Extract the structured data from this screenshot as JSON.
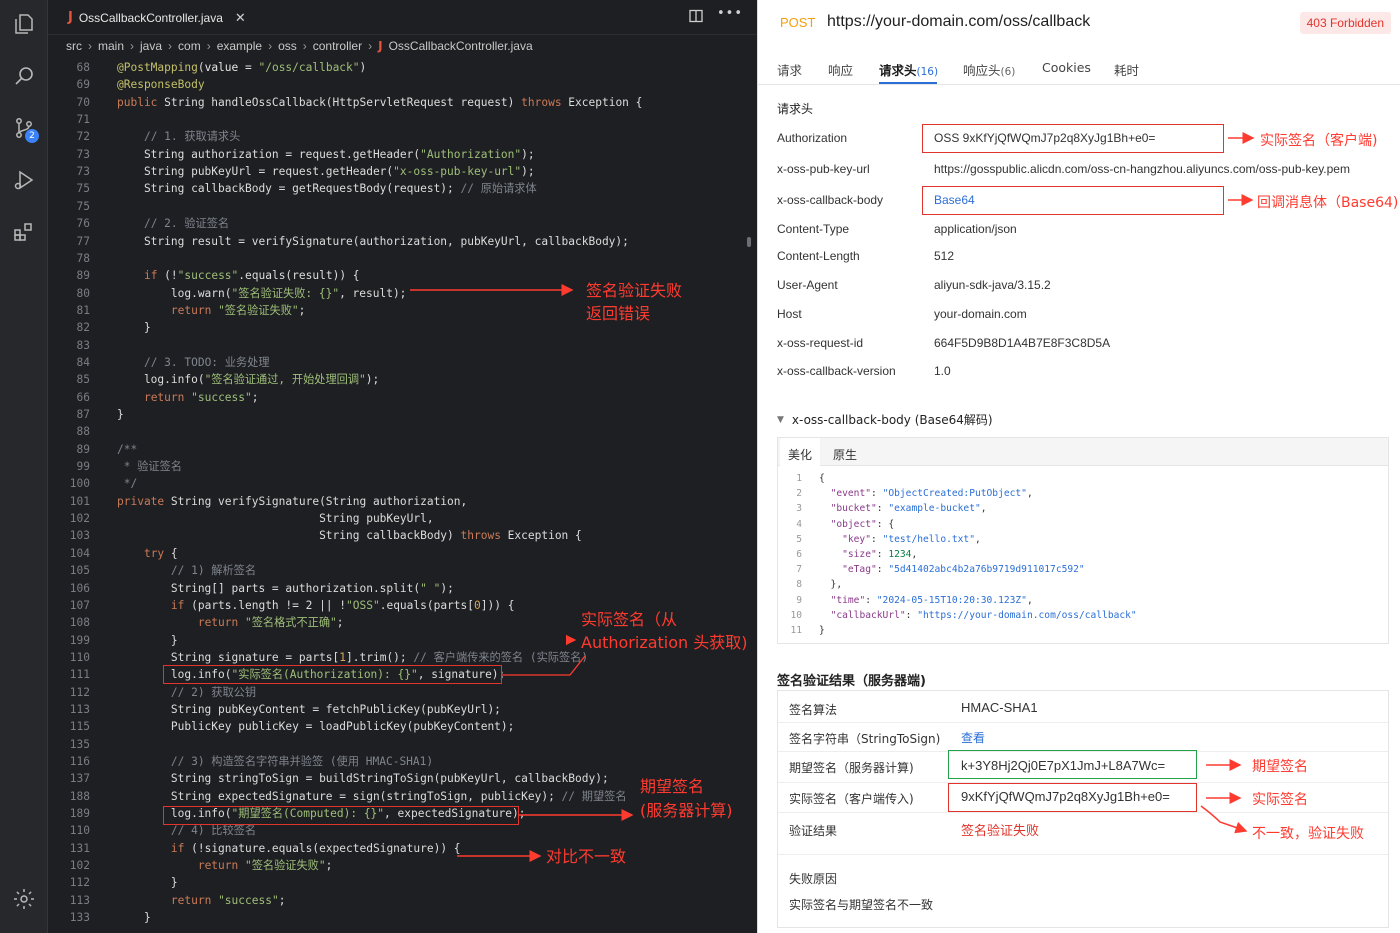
{
  "editor": {
    "tab": {
      "icon": "J",
      "filename": "OssCallbackController.java",
      "close": "✕"
    },
    "breadcrumb": [
      "src",
      "main",
      "java",
      "com",
      "example",
      "oss",
      "controller"
    ],
    "breadcrumb_file_icon": "J",
    "breadcrumb_file": "OssCallbackController.java",
    "badge_count": "2",
    "annotations": {
      "verify_fail": "签名验证失败",
      "return_error": "返回错误",
      "actual_sig_line1": "实际签名（从",
      "actual_sig_line2": "Authorization 头获取)",
      "expected_sig_line1": "期望签名",
      "expected_sig_line2": "(服务器计算)",
      "mismatch": "对比不一致"
    }
  },
  "inspector": {
    "method": "POST",
    "url": "https://your-domain.com/oss/callback",
    "status": "403 Forbidden",
    "tabs": [
      {
        "label": "请求",
        "count": ""
      },
      {
        "label": "响应",
        "count": ""
      },
      {
        "label": "请求头",
        "count": "(16)"
      },
      {
        "label": "响应头",
        "count": "(6)"
      },
      {
        "label": "Cookies",
        "count": ""
      },
      {
        "label": "耗时",
        "count": ""
      }
    ],
    "headers_title": "请求头",
    "headers": [
      {
        "key": "Authorization",
        "value": "OSS 9xKfYjQfWQmJ7p2q8XyJg1Bh+e0="
      },
      {
        "key": "x-oss-pub-key-url",
        "value": "https://gosspublic.alicdn.com/oss-cn-hangzhou.aliyuncs.com/oss-pub-key.pem"
      },
      {
        "key": "x-oss-callback-body",
        "value": "Base64"
      },
      {
        "key": "Content-Type",
        "value": "application/json"
      },
      {
        "key": "Content-Length",
        "value": "512"
      },
      {
        "key": "User-Agent",
        "value": "aliyun-sdk-java/3.15.2"
      },
      {
        "key": "Host",
        "value": "your-domain.com"
      },
      {
        "key": "x-oss-request-id",
        "value": "664F5D9B8D1A4B7E8F3C8D5A"
      },
      {
        "key": "x-oss-callback-version",
        "value": "1.0"
      }
    ],
    "header_annotations": {
      "authorization": "实际签名（客户端)",
      "callback_body": "回调消息体（Base64)"
    },
    "decoded_title": "x-oss-callback-body (Base64解码)",
    "json_tabs": [
      "美化",
      "原生"
    ],
    "verify_title": "签名验证结果（服务器端)",
    "verify": {
      "algo_label": "签名算法",
      "algo_value": "HMAC-SHA1",
      "sts_label": "签名字符串（StringToSign)",
      "sts_value": "查看",
      "expected_label": "期望签名（服务器计算)",
      "expected_value": "k+3Y8Hj2Qj0E7pX1JmJ+L8A7Wc=",
      "actual_label": "实际签名（客户端传入)",
      "actual_value": "9xKfYjQfWQmJ7p2q8XyJg1Bh+e0=",
      "result_label": "验证结果",
      "result_value": "签名验证失败",
      "reason_label": "失败原因",
      "reason_value": "实际签名与期望签名不一致"
    },
    "verify_annotations": {
      "expected": "期望签名",
      "actual": "实际签名",
      "mismatch": "不一致，验证失败"
    }
  },
  "colors": {
    "accent_red": "#e0342c",
    "accent_blue": "#2b6fd6",
    "accent_green": "#22a34a",
    "method_orange": "#f59f0b"
  }
}
